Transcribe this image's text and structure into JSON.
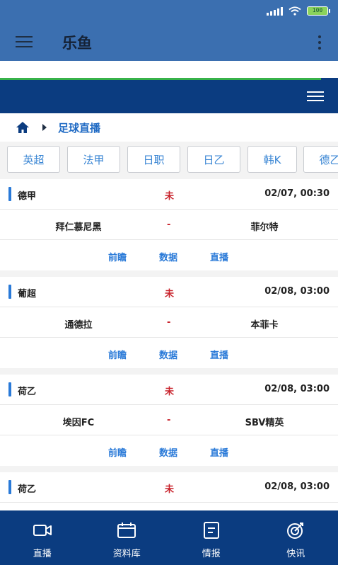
{
  "app": {
    "title": "乐鱼"
  },
  "status_bar": {
    "battery": "100"
  },
  "breadcrumb": {
    "current": "足球直播"
  },
  "league_tabs": [
    "英超",
    "法甲",
    "日职",
    "日乙",
    "韩K",
    "德乙"
  ],
  "matches": [
    {
      "league": "德甲",
      "status": "未",
      "time": "02/07, 00:30",
      "home": "拜仁慕尼黑",
      "sep": "-",
      "away": "菲尔特",
      "links": [
        "前瞻",
        "数据",
        "直播"
      ]
    },
    {
      "league": "葡超",
      "status": "未",
      "time": "02/08, 03:00",
      "home": "通德拉",
      "sep": "-",
      "away": "本菲卡",
      "links": [
        "前瞻",
        "数据",
        "直播"
      ]
    },
    {
      "league": "荷乙",
      "status": "未",
      "time": "02/08, 03:00",
      "home": "埃因FC",
      "sep": "-",
      "away": "SBV精英",
      "links": [
        "前瞻",
        "数据",
        "直播"
      ]
    },
    {
      "league": "荷乙",
      "status": "未",
      "time": "02/08, 03:00"
    }
  ],
  "bottom_nav": [
    {
      "label": "直播",
      "icon": "video-icon"
    },
    {
      "label": "资料库",
      "icon": "calendar-icon"
    },
    {
      "label": "情报",
      "icon": "document-icon"
    },
    {
      "label": "快讯",
      "icon": "target-icon"
    }
  ],
  "colors": {
    "header": "#0b3c80",
    "app_bar": "#3b6fb0",
    "accent": "#2a7ad8",
    "status_red": "#c8232c",
    "progress_green": "#37b24a"
  }
}
